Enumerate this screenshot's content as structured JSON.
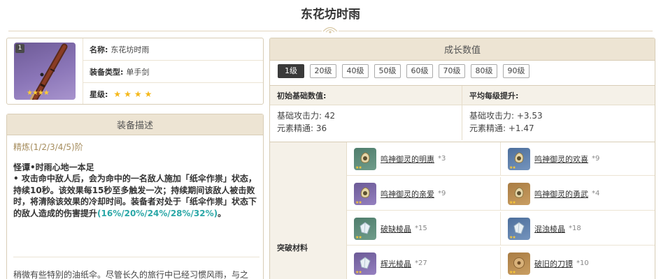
{
  "page": {
    "title": "东花坊时雨"
  },
  "weapon": {
    "level_badge": "1",
    "name_label": "名称:",
    "name": "东花坊时雨",
    "type_label": "装备类型:",
    "type": "单手剑",
    "rarity_label": "星级:",
    "rarity_stars": 4
  },
  "description": {
    "header": "装备描述",
    "refinement": "精炼(1/2/3/4/5)阶",
    "skill_name": "怪谭•时雨心地一本足",
    "skill_text": " • 攻击命中敌人后，会为命中的一名敌人施加「纸伞作祟」状态，持续10秒。该效果每15秒至多触发一次；持续期间该敌人被击败时，将清除该效果的冷却时间。装备者对处于「纸伞作祟」状态下的敌人造成的伤害提升",
    "skill_highlight": "(16%/20%/24%/28%/32%)",
    "skill_tail": "。",
    "flavor": "稍微有些特别的油纸伞。尽管长久的旅行中已经习惯风雨，与之"
  },
  "growth": {
    "header": "成长数值",
    "level_tabs": [
      "1级",
      "20级",
      "40级",
      "50级",
      "60级",
      "70级",
      "80级",
      "90级"
    ],
    "active_tab": 0,
    "base_header": "初始基础数值:",
    "avg_header": "平均每级提升:",
    "base_atk": "基础攻击力: 42",
    "base_em": "元素精通: 36",
    "avg_atk": "基础攻击力: +3.53",
    "avg_em": "元素精通: +1.47",
    "materials_label": "突破材料",
    "materials": [
      {
        "name": "鸣神御灵的明惠",
        "count": "*3",
        "icon": "green-bell-icon",
        "color": "#4f7d6c"
      },
      {
        "name": "鸣神御灵的欢喜",
        "count": "*9",
        "icon": "blue-bell-icon",
        "color": "#4d6f9c"
      },
      {
        "name": "鸣神御灵的亲爱",
        "count": "*9",
        "icon": "purple-bell-icon",
        "color": "#6b5a96"
      },
      {
        "name": "鸣神御灵的勇武",
        "count": "*4",
        "icon": "gold-bell-icon",
        "color": "#a97c43"
      },
      {
        "name": "破缺棱晶",
        "count": "*15",
        "icon": "green-prism-icon",
        "color": "#4f7d6c"
      },
      {
        "name": "混浊棱晶",
        "count": "*18",
        "icon": "blue-prism-icon",
        "color": "#4d6f9c"
      },
      {
        "name": "辉光棱晶",
        "count": "*27",
        "icon": "purple-prism-icon",
        "color": "#6b5a96"
      },
      {
        "name": "破旧的刀镡",
        "count": "*10",
        "icon": "gold-guard-icon",
        "color": "#a97c43"
      }
    ]
  }
}
